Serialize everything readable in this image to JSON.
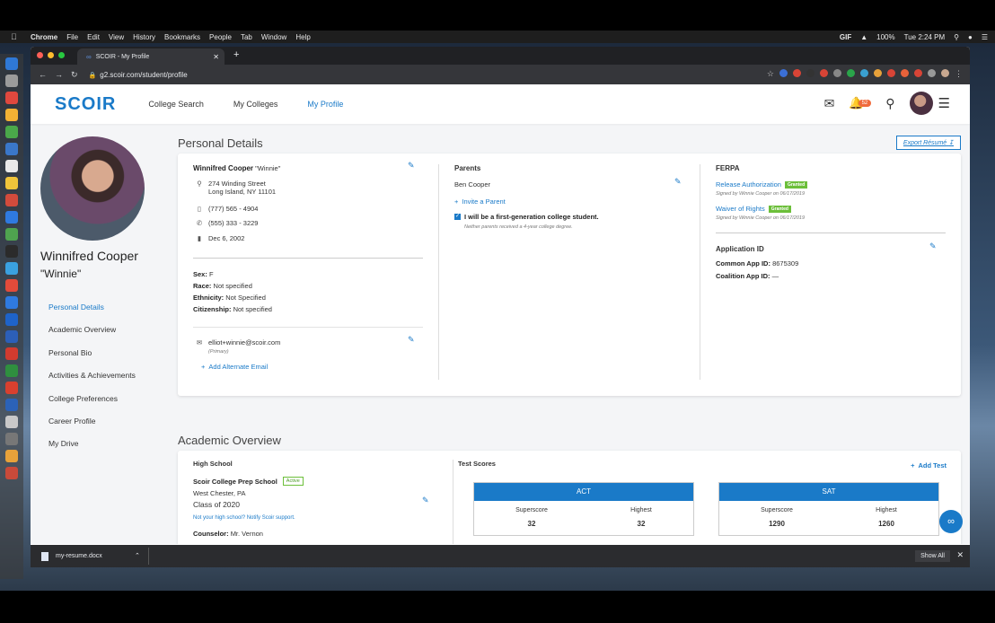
{
  "menubar": {
    "app_name": "Chrome",
    "items": [
      "File",
      "Edit",
      "View",
      "History",
      "Bookmarks",
      "People",
      "Tab",
      "Window",
      "Help"
    ],
    "gif": "GIF",
    "battery": "100%",
    "clock": "Tue 2:24 PM"
  },
  "browser": {
    "tab_title": "SCOIR - My Profile",
    "url": "g2.scoir.com/student/profile",
    "new_tab": "+"
  },
  "header": {
    "logo": "SCOIR",
    "nav": [
      "College Search",
      "My Colleges",
      "My Profile"
    ],
    "notification_count": "52"
  },
  "sidebar": {
    "name": "Winnifred Cooper",
    "nickname": "\"Winnie\"",
    "items": [
      "Personal Details",
      "Academic Overview",
      "Personal Bio",
      "Activities & Achievements",
      "College Preferences",
      "Career Profile",
      "My Drive"
    ]
  },
  "personal": {
    "section_title": "Personal Details",
    "export_label": "Export Résumé",
    "name": "Winnifred Cooper",
    "nickname": "\"Winnie\"",
    "address_line1": "274 Winding Street",
    "address_line2": "Long Island, NY 11101",
    "mobile": "(777) 565 - 4904",
    "phone": "(555) 333 - 3229",
    "birthday": "Dec 6, 2002",
    "sex_label": "Sex:",
    "sex": "F",
    "race_label": "Race:",
    "race": "Not specified",
    "ethnicity_label": "Ethnicity:",
    "ethnicity": "Not Specified",
    "citizenship_label": "Citizenship:",
    "citizenship": "Not specified",
    "email": "elliot+winnie@scoir.com",
    "email_note": "(Primary)",
    "add_email": "Add Alternate Email"
  },
  "parents": {
    "title": "Parents",
    "parent_name": "Ben Cooper",
    "invite": "Invite a Parent",
    "first_gen": "I will be a first-generation college student.",
    "first_gen_note": "Neither parents received a 4-year college degree."
  },
  "ferpa": {
    "title": "FERPA",
    "release": "Release Authorization",
    "release_status": "Granted",
    "release_signed": "Signed by Winnie Cooper on 06/17/2019",
    "waiver": "Waiver of Rights",
    "waiver_status": "Granted",
    "waiver_signed": "Signed by Winnie Cooper on 06/17/2019",
    "app_id_title": "Application ID",
    "common_label": "Common App ID:",
    "common_value": "8675309",
    "coalition_label": "Coalition App ID:",
    "coalition_value": "—"
  },
  "academic": {
    "section_title": "Academic Overview",
    "hs_title": "High School",
    "school": "Scoir College Prep School",
    "status": "Active",
    "location": "West Chester, PA",
    "class": "Class of 2020",
    "not_your_school": "Not your high school? Notify Scoir support.",
    "counselor_label": "Counselor:",
    "counselor": "Mr. Vernon",
    "tests_title": "Test Scores",
    "add_test": "Add Test",
    "act": {
      "name": "ACT",
      "superscore_label": "Superscore",
      "highest_label": "Highest",
      "superscore": "32",
      "highest": "32"
    },
    "sat": {
      "name": "SAT",
      "superscore_label": "Superscore",
      "highest_label": "Highest",
      "superscore": "1290",
      "highest": "1260"
    }
  },
  "downloads": {
    "file": "my-resume.docx",
    "show_all": "Show All"
  }
}
